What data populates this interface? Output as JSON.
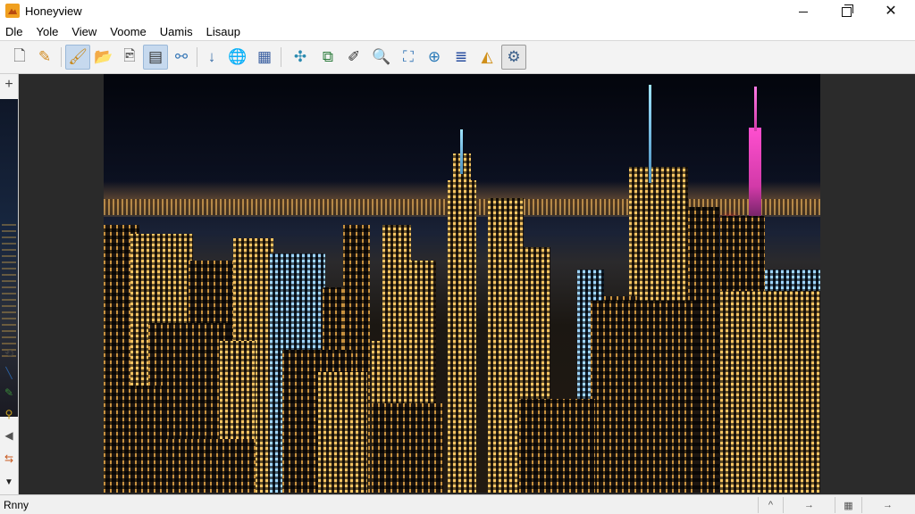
{
  "window": {
    "title": "Honeyview",
    "icon": "honeyview-app-icon"
  },
  "menubar": {
    "items": [
      "Dle",
      "Yole",
      "View",
      "Voome",
      "Uamis",
      "Lisaup"
    ]
  },
  "toolbar": {
    "buttons": [
      {
        "icon": "new-file-icon",
        "glyph": "🗋"
      },
      {
        "icon": "edit-pencil-icon",
        "glyph": "✎"
      },
      {
        "icon": "paint-format-icon",
        "glyph": "🖌"
      },
      {
        "icon": "folder-icon",
        "glyph": "📂"
      },
      {
        "icon": "image-settings-icon",
        "glyph": "🖻"
      },
      {
        "icon": "slideshow-icon",
        "glyph": "▤"
      },
      {
        "icon": "share-icon",
        "glyph": "⚯"
      },
      {
        "icon": "download-arrow-icon",
        "glyph": "↓"
      },
      {
        "icon": "globe-search-icon",
        "glyph": "🌐"
      },
      {
        "icon": "grid-view-icon",
        "glyph": "▦"
      },
      {
        "icon": "puzzle-icon",
        "glyph": "✣"
      },
      {
        "icon": "crop-icon",
        "glyph": "⧉"
      },
      {
        "icon": "draw-line-icon",
        "glyph": "✐"
      },
      {
        "icon": "magnifier-icon",
        "glyph": "🔍"
      },
      {
        "icon": "fit-screen-icon",
        "glyph": "⛶"
      },
      {
        "icon": "zoom-in-icon",
        "glyph": "⊕"
      },
      {
        "icon": "list-settings-icon",
        "glyph": "≣"
      },
      {
        "icon": "color-adjust-icon",
        "glyph": "◭"
      },
      {
        "icon": "gear-icon",
        "glyph": "⚙"
      }
    ]
  },
  "sidebar": {
    "icons": [
      {
        "icon": "crosshair-icon",
        "glyph": "+"
      },
      {
        "icon": "rotate-icon",
        "glyph": "⟲"
      },
      {
        "icon": "brush-icon",
        "glyph": "╲"
      },
      {
        "icon": "eyedropper-icon",
        "glyph": "✎"
      },
      {
        "icon": "filter-icon",
        "glyph": "⚲"
      },
      {
        "icon": "flip-icon",
        "glyph": "◀"
      },
      {
        "icon": "swap-arrows-icon",
        "glyph": "⇆"
      },
      {
        "icon": "triangle-down-icon",
        "glyph": "▼"
      }
    ]
  },
  "statusbar": {
    "text": "Rnny",
    "segments": [
      {
        "icon": "caret-up-icon",
        "glyph": "^"
      },
      {
        "icon": "arrow-right-icon",
        "glyph": "→"
      },
      {
        "icon": "grid-small-icon",
        "glyph": "▦"
      },
      {
        "icon": "arrow-right-small-icon",
        "glyph": "→"
      }
    ]
  },
  "colors": {
    "accent": "#c6d9ee",
    "canvas": "#262626"
  }
}
